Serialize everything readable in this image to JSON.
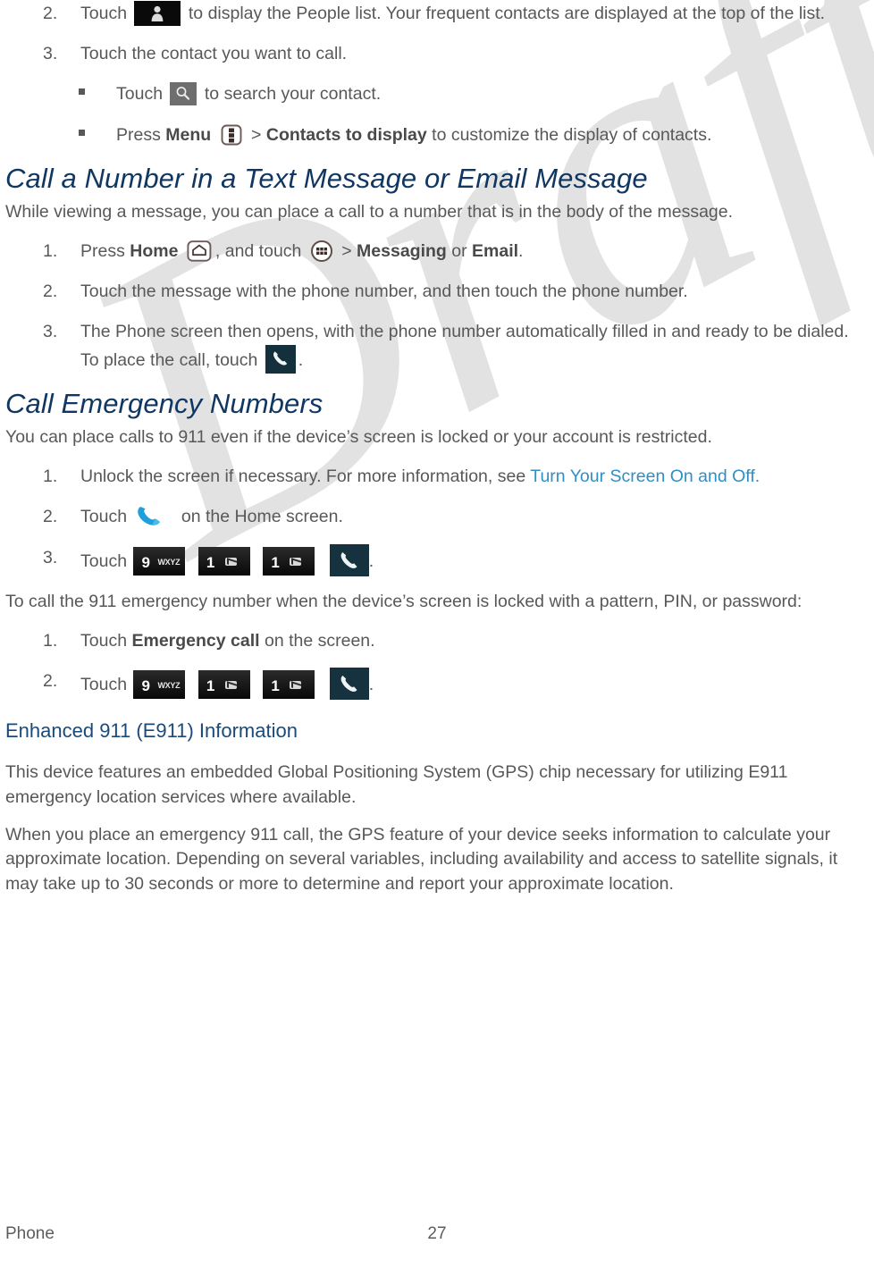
{
  "document": {
    "watermark": "Draft",
    "footer": {
      "left": "Phone",
      "page_number": "27"
    }
  },
  "colors": {
    "heading": "#103762",
    "subheading": "#1a4a7a",
    "body": "#58585a",
    "link": "#2f8fc4",
    "watermark": "#e2e2e2",
    "key_dark": "#0a0a0a",
    "call_button": "#14303c",
    "phone_blue": "#1fa0dc"
  },
  "content": {
    "step2_people": {
      "marker": "2.",
      "pre": "Touch",
      "icon": "people-icon",
      "post": "to display the People list. Your frequent contacts are displayed at the top of the list."
    },
    "step3_contact": {
      "marker": "3.",
      "text": "Touch the contact you want to call."
    },
    "bullet_search": {
      "pre": "Touch",
      "icon": "search-icon",
      "post": "to search your contact."
    },
    "bullet_menu": {
      "pre": "Press",
      "bold1": "Menu",
      "icon": "menu-icon",
      "sep": ">",
      "bold2": "Contacts to display",
      "post": "to customize the display of contacts."
    },
    "section_text_message": {
      "heading": "Call a Number in a Text Message or Email Message",
      "intro": "While viewing a message, you can place a call to a number that is in the body of the message.",
      "steps": [
        {
          "marker": "1.",
          "pre": "Press",
          "bold1": "Home",
          "icon1": "home-icon",
          "mid": ", and touch",
          "icon2": "apps-icon",
          "sep": ">",
          "bold2": "Messaging",
          "mid2": "or",
          "bold3": "Email",
          "post": "."
        },
        {
          "marker": "2.",
          "text": "Touch the message with the phone number, and then touch the phone number."
        },
        {
          "marker": "3.",
          "pre": "The Phone screen then opens, with the phone number automatically filled in and ready to be dialed. To place the call, touch",
          "icon": "call-button-icon",
          "post": "."
        }
      ]
    },
    "section_emergency": {
      "heading": "Call Emergency Numbers",
      "intro": "You can place calls to 911 even if the device’s screen is locked or your account is restricted.",
      "steps": [
        {
          "marker": "1.",
          "pre": "Unlock the screen if necessary. For more information, see",
          "link": "Turn Your Screen On and Off.",
          "post": ""
        },
        {
          "marker": "2.",
          "pre": "Touch",
          "icon": "phone-handset-blue-icon",
          "post": "on the Home screen."
        },
        {
          "marker": "3.",
          "pre": "Touch",
          "keys": [
            "9-wxyz-key",
            "1-voicemail-key",
            "1-voicemail-key",
            "call-button-icon"
          ],
          "post": "."
        }
      ],
      "locked_intro": "To call the 911 emergency number when the device’s screen is locked with a pattern, PIN, or password:",
      "locked_steps": [
        {
          "marker": "1.",
          "pre": "Touch",
          "bold": "Emergency call",
          "post": "on the screen."
        },
        {
          "marker": "2.",
          "pre": "Touch",
          "keys": [
            "9-wxyz-key",
            "1-voicemail-key",
            "1-voicemail-key",
            "call-button-icon"
          ],
          "post": "."
        }
      ]
    },
    "section_e911": {
      "subheading": "Enhanced 911 (E911) Information",
      "paragraphs": [
        "This device features an embedded Global Positioning System (GPS) chip necessary for utilizing E911 emergency location services where available.",
        "When you place an emergency 911 call, the GPS feature of your device seeks information to calculate your approximate location. Depending on several variables, including availability and access to satellite signals, it may take up to 30 seconds or more to determine and report your approximate location."
      ]
    },
    "keys": {
      "nine": {
        "digit": "9",
        "letters": "WXYZ"
      },
      "one": {
        "digit": "1",
        "letters": ""
      }
    }
  }
}
